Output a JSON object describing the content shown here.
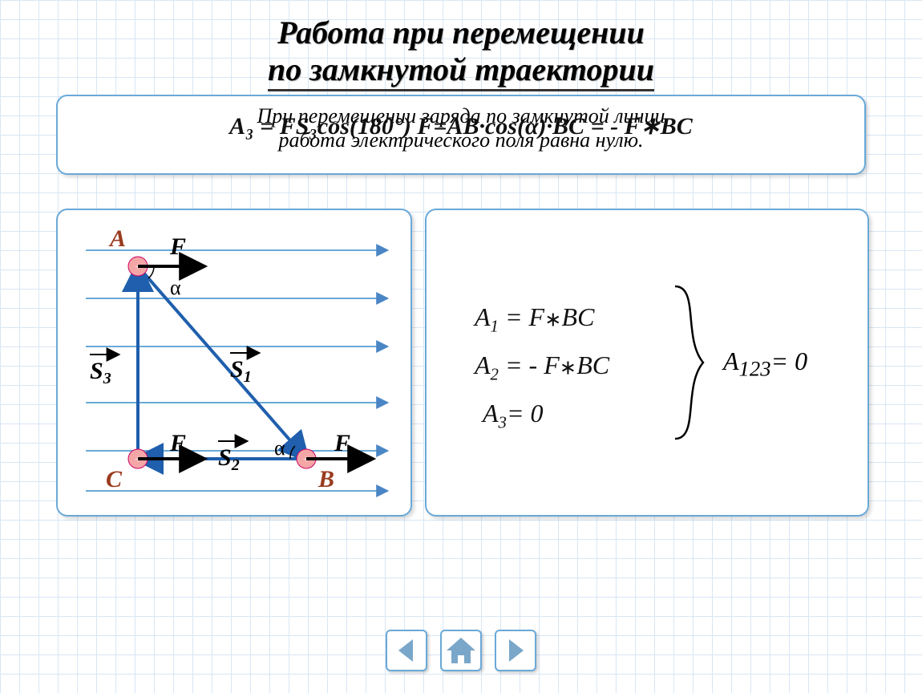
{
  "title_line1": "Работа при перемещении",
  "title_line2": "по замкнутой траектории",
  "top_box": {
    "line1": "При перемещении заряда по замкнутой линии",
    "line2": "работа электрического поля равна нулю."
  },
  "overlay_equation": "A₃ = FS₃cos(180°) F=AB·cos(α)·BC = - F∗BC",
  "diagram": {
    "points": {
      "A": "A",
      "B": "B",
      "C": "C"
    },
    "forces": {
      "F_A": "F",
      "F_B": "F",
      "F_C": "F"
    },
    "segments": {
      "S1": "S₁",
      "S2": "S₂",
      "S3": "S₃"
    },
    "angle_label": "α"
  },
  "equations": {
    "e1": "A₁ = F∗BC",
    "e2": "A₂ = - F∗BC",
    "e3": "A₃= 0",
    "result": "A₁₂₃= 0"
  },
  "nav": {
    "prev": "previous",
    "home": "home",
    "next": "next"
  }
}
